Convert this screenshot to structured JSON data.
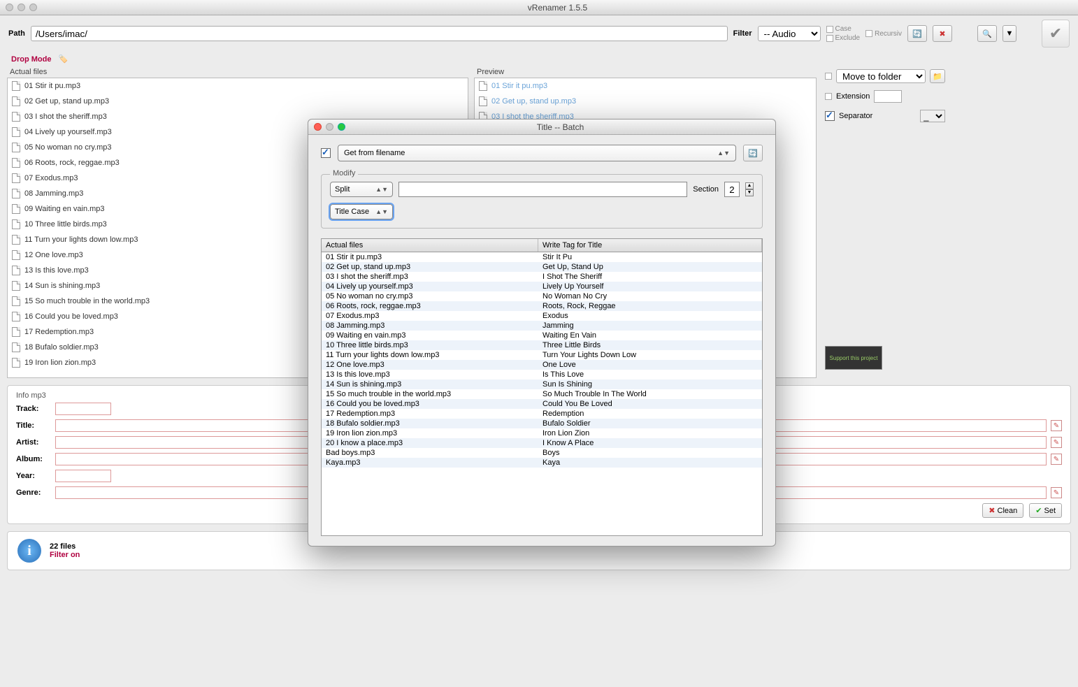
{
  "window": {
    "title": "vRenamer 1.5.5"
  },
  "toolbar": {
    "path_label": "Path",
    "path_value": "/Users/imac/",
    "filter_label": "Filter",
    "filter_value": "-- Audio",
    "case": "Case",
    "exclude": "Exclude",
    "recursiv": "Recursiv"
  },
  "drop_mode": "Drop Mode",
  "panels": {
    "actual": "Actual files",
    "preview": "Preview"
  },
  "files": [
    "01 Stir it pu.mp3",
    "02 Get up, stand up.mp3",
    "03 I shot the sheriff.mp3",
    "04 Lively up yourself.mp3",
    "05 No woman no cry.mp3",
    "06 Roots, rock, reggae.mp3",
    "07 Exodus.mp3",
    "08 Jamming.mp3",
    "09 Waiting en vain.mp3",
    "10 Three little birds.mp3",
    "11 Turn your lights down low.mp3",
    "12 One love.mp3",
    "13 Is this love.mp3",
    "14 Sun is shining.mp3",
    "15 So much trouble in the world.mp3",
    "16 Could you be loved.mp3",
    "17 Redemption.mp3",
    "18 Bufalo soldier.mp3",
    "19 Iron lion zion.mp3"
  ],
  "preview_files": [
    "01 Stir it pu.mp3",
    "02 Get up, stand up.mp3",
    "03 I shot the sheriff.mp3"
  ],
  "right": {
    "move_to": "Move to folder",
    "extension": "Extension",
    "separator": "Separator",
    "sep_val": "_"
  },
  "info": {
    "title_panel": "Info mp3",
    "track": "Track:",
    "ttl": "Title:",
    "artist": "Artist:",
    "album": "Album:",
    "year": "Year:",
    "genre": "Genre:",
    "clean": "Clean",
    "set": "Set"
  },
  "status": {
    "count": "22 files",
    "filter": "Filter on"
  },
  "modal": {
    "title": "Title -- Batch",
    "source": "Get from filename",
    "modify": "Modify",
    "split": "Split",
    "section": "Section",
    "section_val": "2",
    "case_sel": "Title Case",
    "col_actual": "Actual files",
    "col_write": "Write Tag for Title",
    "rows": [
      {
        "a": "01 Stir it pu.mp3",
        "b": "Stir It Pu"
      },
      {
        "a": "02 Get up, stand up.mp3",
        "b": "Get Up, Stand Up"
      },
      {
        "a": "03 I shot the sheriff.mp3",
        "b": "I Shot The Sheriff"
      },
      {
        "a": "04 Lively up yourself.mp3",
        "b": "Lively Up Yourself"
      },
      {
        "a": "05 No woman no cry.mp3",
        "b": "No Woman No Cry"
      },
      {
        "a": "06 Roots, rock, reggae.mp3",
        "b": "Roots, Rock, Reggae"
      },
      {
        "a": "07 Exodus.mp3",
        "b": "Exodus"
      },
      {
        "a": "08 Jamming.mp3",
        "b": "Jamming"
      },
      {
        "a": "09 Waiting en vain.mp3",
        "b": "Waiting En Vain"
      },
      {
        "a": "10 Three little birds.mp3",
        "b": "Three Little Birds"
      },
      {
        "a": "11 Turn your lights down low.mp3",
        "b": "Turn Your Lights Down Low"
      },
      {
        "a": "12 One love.mp3",
        "b": "One Love"
      },
      {
        "a": "13 Is this love.mp3",
        "b": "Is This Love"
      },
      {
        "a": "14 Sun is shining.mp3",
        "b": "Sun Is Shining"
      },
      {
        "a": "15 So much trouble in the world.mp3",
        "b": "So Much Trouble In The World"
      },
      {
        "a": "16 Could you be loved.mp3",
        "b": "Could You Be Loved"
      },
      {
        "a": "17 Redemption.mp3",
        "b": "Redemption"
      },
      {
        "a": "18 Bufalo soldier.mp3",
        "b": "Bufalo Soldier"
      },
      {
        "a": "19 Iron lion zion.mp3",
        "b": "Iron Lion Zion"
      },
      {
        "a": "20 I know a place.mp3",
        "b": "I Know A Place"
      },
      {
        "a": "Bad boys.mp3",
        "b": "Boys"
      },
      {
        "a": "Kaya.mp3",
        "b": "Kaya"
      }
    ]
  },
  "support": "Support this project"
}
